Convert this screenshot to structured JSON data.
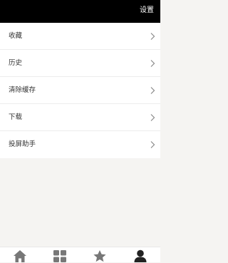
{
  "header": {
    "title": "设置"
  },
  "menu": {
    "items": [
      {
        "label": "收藏"
      },
      {
        "label": "历史"
      },
      {
        "label": "清除缓存"
      },
      {
        "label": "下载"
      },
      {
        "label": "投屏助手"
      }
    ]
  },
  "tabbar": {
    "tabs": [
      {
        "icon": "home-icon",
        "color": "#777777"
      },
      {
        "icon": "grid-icon",
        "color": "#777777"
      },
      {
        "icon": "star-icon",
        "color": "#777777"
      },
      {
        "icon": "user-icon",
        "color": "#222222",
        "active": true
      }
    ]
  }
}
